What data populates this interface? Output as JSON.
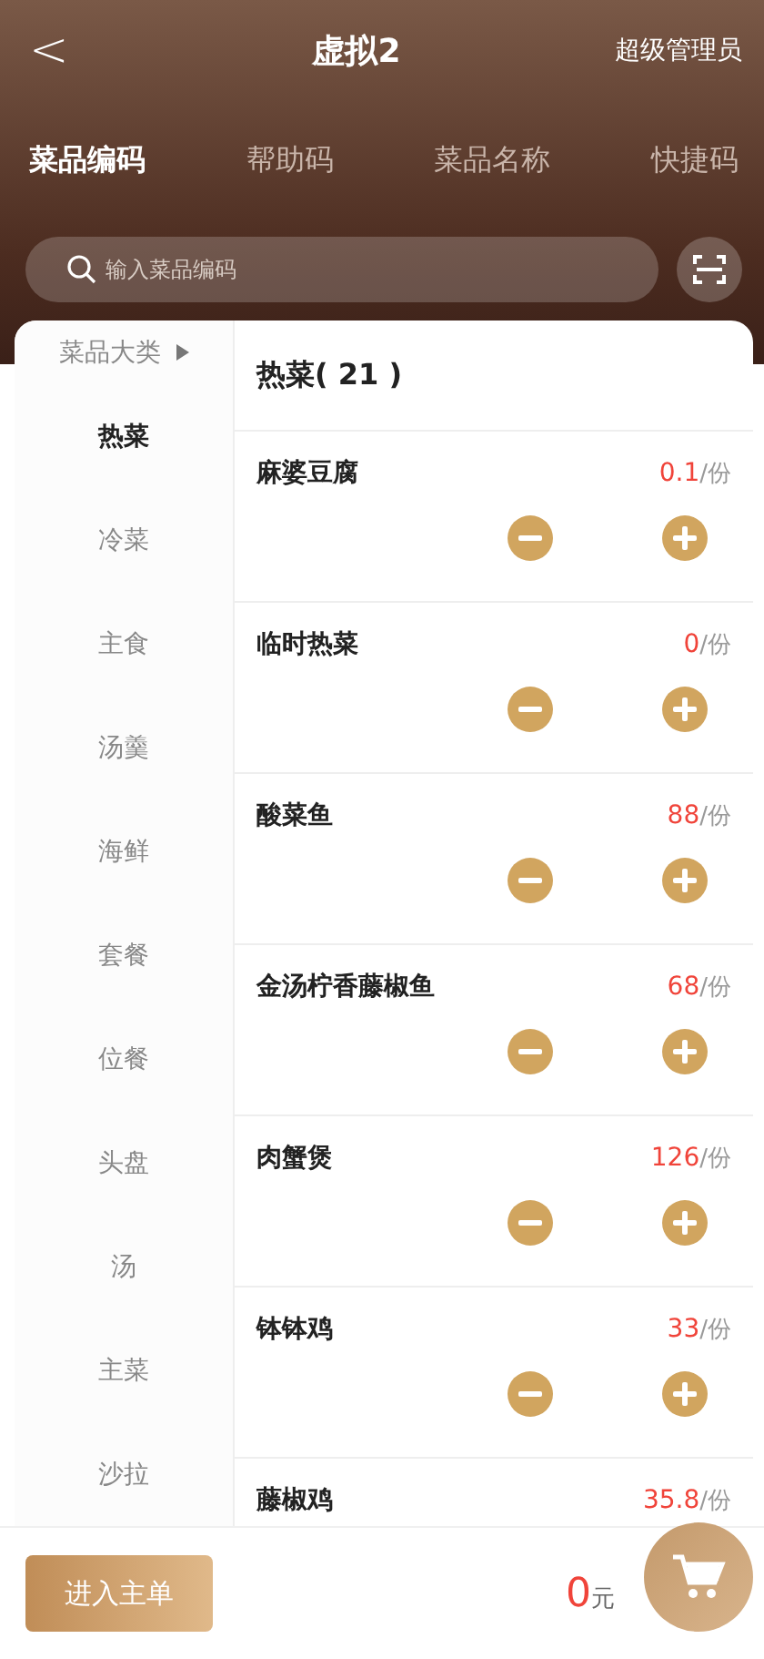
{
  "header": {
    "back": "<",
    "title": "虚拟2",
    "user": "超级管理员"
  },
  "tabs": [
    {
      "label": "菜品编码",
      "selected": true
    },
    {
      "label": "帮助码",
      "selected": false
    },
    {
      "label": "菜品名称",
      "selected": false
    },
    {
      "label": "快捷码",
      "selected": false
    }
  ],
  "search": {
    "placeholder": "输入菜品编码"
  },
  "sidebar": {
    "heading": "菜品大类",
    "items": [
      {
        "label": "热菜",
        "selected": true
      },
      {
        "label": "冷菜",
        "selected": false
      },
      {
        "label": "主食",
        "selected": false
      },
      {
        "label": "汤羹",
        "selected": false
      },
      {
        "label": "海鲜",
        "selected": false
      },
      {
        "label": "套餐",
        "selected": false
      },
      {
        "label": "位餐",
        "selected": false
      },
      {
        "label": "头盘",
        "selected": false
      },
      {
        "label": "汤",
        "selected": false
      },
      {
        "label": "主菜",
        "selected": false
      },
      {
        "label": "沙拉",
        "selected": false
      }
    ]
  },
  "list": {
    "heading": "热菜( 21 )",
    "dishes": [
      {
        "name": "麻婆豆腐",
        "price": "0.1",
        "unit": "/份"
      },
      {
        "name": "临时热菜",
        "price": "0",
        "unit": "/份"
      },
      {
        "name": "酸菜鱼",
        "price": "88",
        "unit": "/份"
      },
      {
        "name": "金汤柠香藤椒鱼",
        "price": "68",
        "unit": "/份"
      },
      {
        "name": "肉蟹煲",
        "price": "126",
        "unit": "/份"
      },
      {
        "name": "钵钵鸡",
        "price": "33",
        "unit": "/份"
      },
      {
        "name": "藤椒鸡",
        "price": "35.8",
        "unit": "/份",
        "steppers": false
      }
    ]
  },
  "footer": {
    "button": "进入主单",
    "total": "0",
    "currency": "元"
  }
}
